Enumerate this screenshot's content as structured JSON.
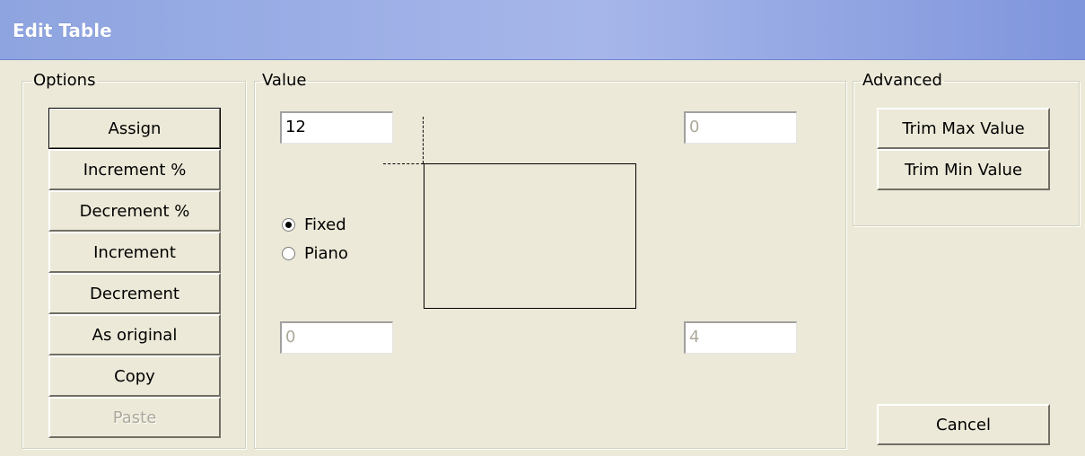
{
  "window": {
    "title": "Edit Table"
  },
  "options": {
    "legend": "Options",
    "buttons": [
      {
        "label": "Assign"
      },
      {
        "label": "Increment %"
      },
      {
        "label": "Decrement %"
      },
      {
        "label": "Increment"
      },
      {
        "label": "Decrement"
      },
      {
        "label": "As original"
      },
      {
        "label": "Copy"
      },
      {
        "label": "Paste"
      }
    ]
  },
  "value": {
    "legend": "Value",
    "top_left_value": "12",
    "top_right_value": "0",
    "bottom_left_value": "0",
    "bottom_right_value": "4",
    "radio_fixed": "Fixed",
    "radio_piano": "Piano",
    "selected": "Fixed"
  },
  "advanced": {
    "legend": "Advanced",
    "trim_max_label": "Trim Max Value",
    "trim_min_label": "Trim Min Value"
  },
  "cancel_label": "Cancel"
}
